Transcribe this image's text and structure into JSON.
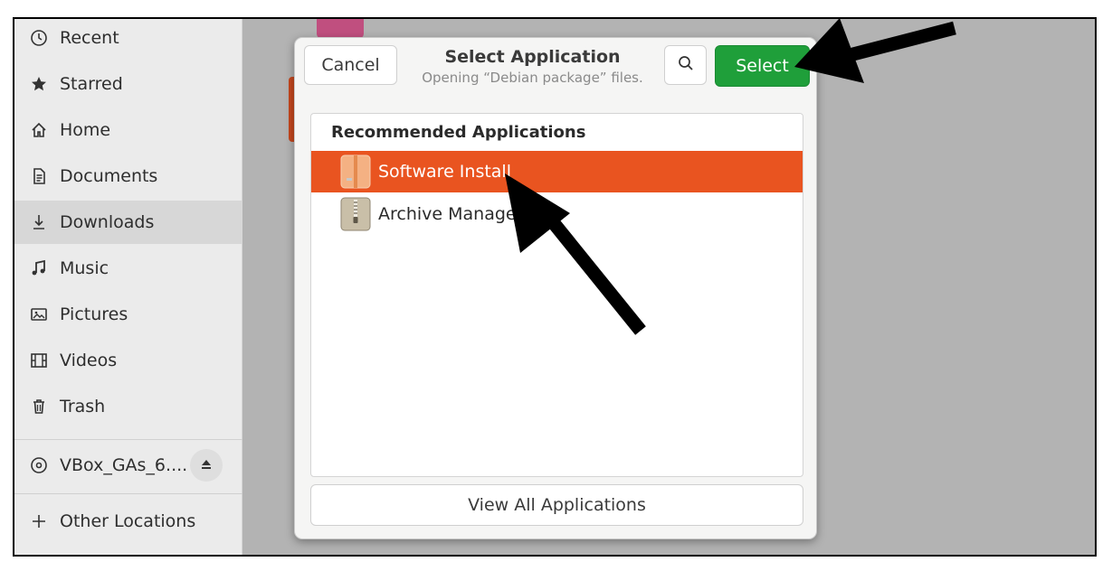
{
  "sidebar": {
    "items": [
      {
        "label": "Recent",
        "icon": "clock-icon"
      },
      {
        "label": "Starred",
        "icon": "star-icon"
      },
      {
        "label": "Home",
        "icon": "home-icon"
      },
      {
        "label": "Documents",
        "icon": "document-icon"
      },
      {
        "label": "Downloads",
        "icon": "download-icon",
        "active": true
      },
      {
        "label": "Music",
        "icon": "music-icon"
      },
      {
        "label": "Pictures",
        "icon": "picture-icon"
      },
      {
        "label": "Videos",
        "icon": "video-icon"
      },
      {
        "label": "Trash",
        "icon": "trash-icon"
      }
    ],
    "device": {
      "label": "VBox_GAs_6....",
      "icon": "disc-icon",
      "eject_icon": "eject-icon"
    },
    "other": {
      "label": "Other Locations",
      "icon": "plus-icon"
    }
  },
  "dialog": {
    "title": "Select Application",
    "subtitle": "Opening “Debian package” files.",
    "cancel_label": "Cancel",
    "select_label": "Select",
    "search_icon": "search-icon",
    "list_heading": "Recommended Applications",
    "apps": [
      {
        "label": "Software Install",
        "icon": "package-icon",
        "selected": true
      },
      {
        "label": "Archive Manager",
        "icon": "archive-icon",
        "selected": false
      }
    ],
    "view_all_label": "View All Applications"
  },
  "colors": {
    "accent": "#e95420",
    "select_button": "#1f9f3a",
    "sidebar_bg": "#ebebeb",
    "backdrop": "#b3b3b3"
  }
}
